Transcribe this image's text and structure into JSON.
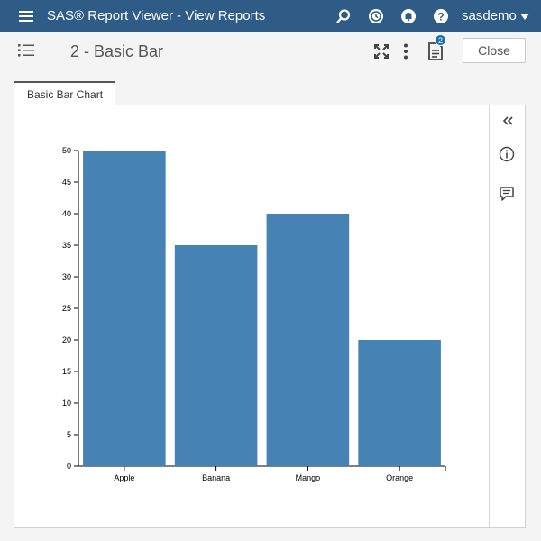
{
  "app": {
    "title": "SAS® Report Viewer - View Reports",
    "user": "sasdemo",
    "icons": [
      "menu-icon",
      "search-icon",
      "history-icon",
      "notifications-icon",
      "help-icon",
      "caret-down-icon"
    ]
  },
  "toolbar": {
    "report_title": "2 - Basic Bar",
    "notes_badge": "2",
    "close_label": "Close",
    "icons": [
      "table-of-contents-icon",
      "maximize-icon",
      "more-icon",
      "notes-icon"
    ]
  },
  "tabs": [
    {
      "label": "Basic Bar Chart",
      "selected": true
    }
  ],
  "side_rail": {
    "icons": [
      "collapse-icon",
      "info-icon",
      "comment-icon"
    ]
  },
  "colors": {
    "header_bg": "#2f5c86",
    "bar_fill": "#4682b4",
    "badge": "#1b6fb0"
  },
  "chart_data": {
    "type": "bar",
    "categories": [
      "Apple",
      "Banana",
      "Mango",
      "Orange"
    ],
    "values": [
      50,
      35,
      40,
      20
    ],
    "ylim": [
      0,
      50
    ],
    "yticks": [
      0,
      5,
      10,
      15,
      20,
      25,
      30,
      35,
      40,
      45,
      50
    ],
    "title": "",
    "xlabel": "",
    "ylabel": "",
    "grid": false,
    "legend": "none"
  }
}
